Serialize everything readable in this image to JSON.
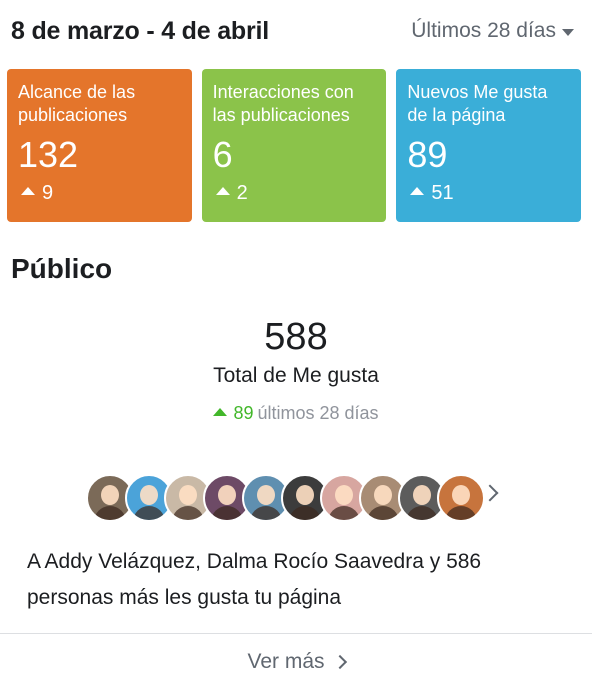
{
  "header": {
    "date_range": "8 de marzo - 4 de abril",
    "period": "Últimos 28 días",
    "period_icon": "caret-down-icon"
  },
  "cards": [
    {
      "title": "Alcance de las publicaciones",
      "value": "132",
      "delta": "9",
      "color": "#e4752b",
      "icon": "up-triangle-icon"
    },
    {
      "title": "Interacciones con las publicaciones",
      "value": "6",
      "delta": "2",
      "color": "#8bc34a",
      "icon": "up-triangle-icon"
    },
    {
      "title": "Nuevos Me gusta de la página",
      "value": "89",
      "delta": "51",
      "color": "#3aaed8",
      "icon": "up-triangle-icon"
    }
  ],
  "audience": {
    "title": "Público",
    "total": "588",
    "total_label": "Total de Me gusta",
    "delta": "89",
    "delta_label": "últimos 28 días",
    "delta_color": "#42b72a",
    "avatar_colors": [
      "#7b6a58",
      "#4ba3d9",
      "#c9b9a6",
      "#6d4a66",
      "#5f8fb0",
      "#3c3c3c",
      "#d7a6a0",
      "#a88c74",
      "#5c5c5c",
      "#c7743d"
    ],
    "likes_text": "A Addy Velázquez, Dalma Rocío Saavedra y 586 personas más les gusta tu página",
    "see_more": "Ver más"
  }
}
